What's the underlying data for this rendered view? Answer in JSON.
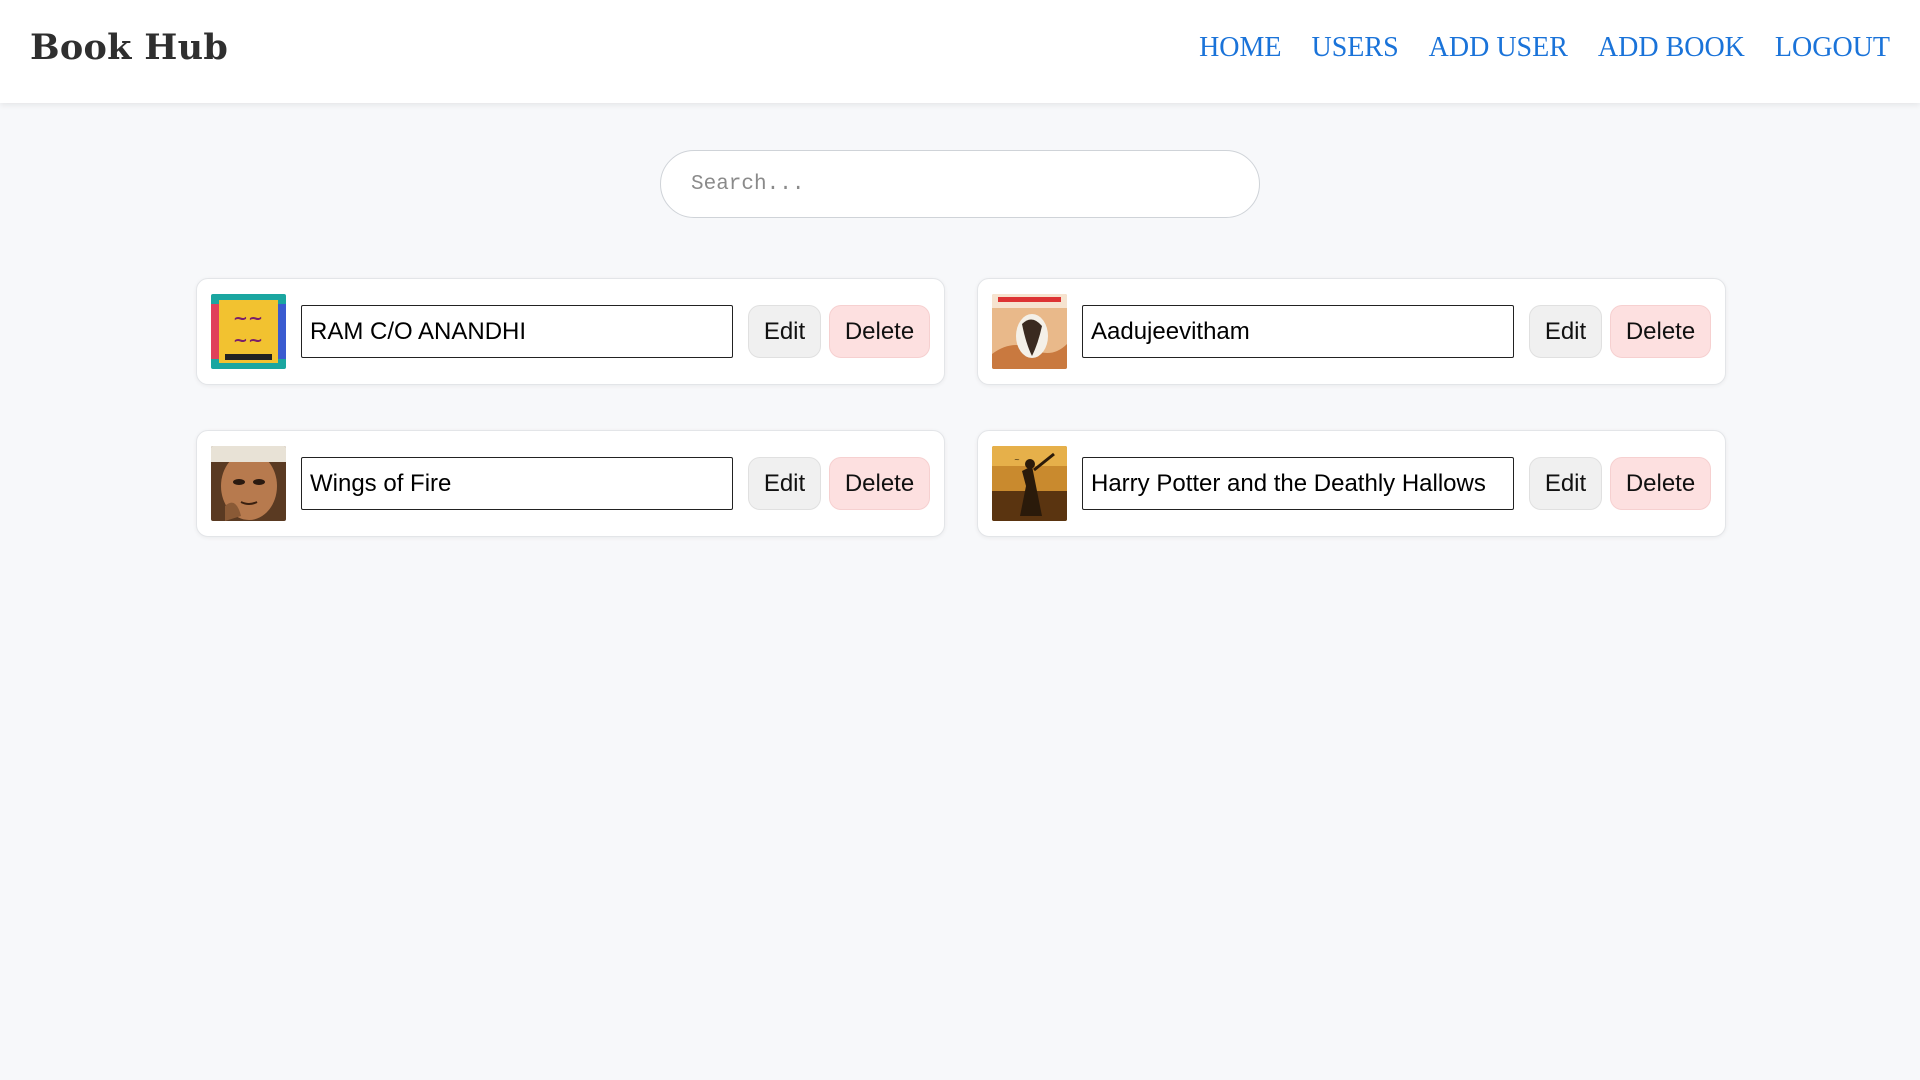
{
  "brand": "Book Hub",
  "nav": [
    {
      "label": "HOME"
    },
    {
      "label": "USERS"
    },
    {
      "label": "ADD USER"
    },
    {
      "label": "ADD BOOK"
    },
    {
      "label": "LOGOUT"
    }
  ],
  "search": {
    "placeholder": "Search...",
    "value": ""
  },
  "books": [
    {
      "title": "RAM C/O ANANDHI",
      "edit_label": "Edit",
      "delete_label": "Delete"
    },
    {
      "title": "Aadujeevitham",
      "edit_label": "Edit",
      "delete_label": "Delete"
    },
    {
      "title": "Wings of Fire",
      "edit_label": "Edit",
      "delete_label": "Delete"
    },
    {
      "title": "Harry Potter and the Deathly Hallows",
      "edit_label": "Edit",
      "delete_label": "Delete"
    }
  ],
  "colors": {
    "link": "#1a73d9",
    "delete_bg": "#fde0e0",
    "edit_bg": "#f0f0f0",
    "page_bg": "#f7f8fa"
  }
}
